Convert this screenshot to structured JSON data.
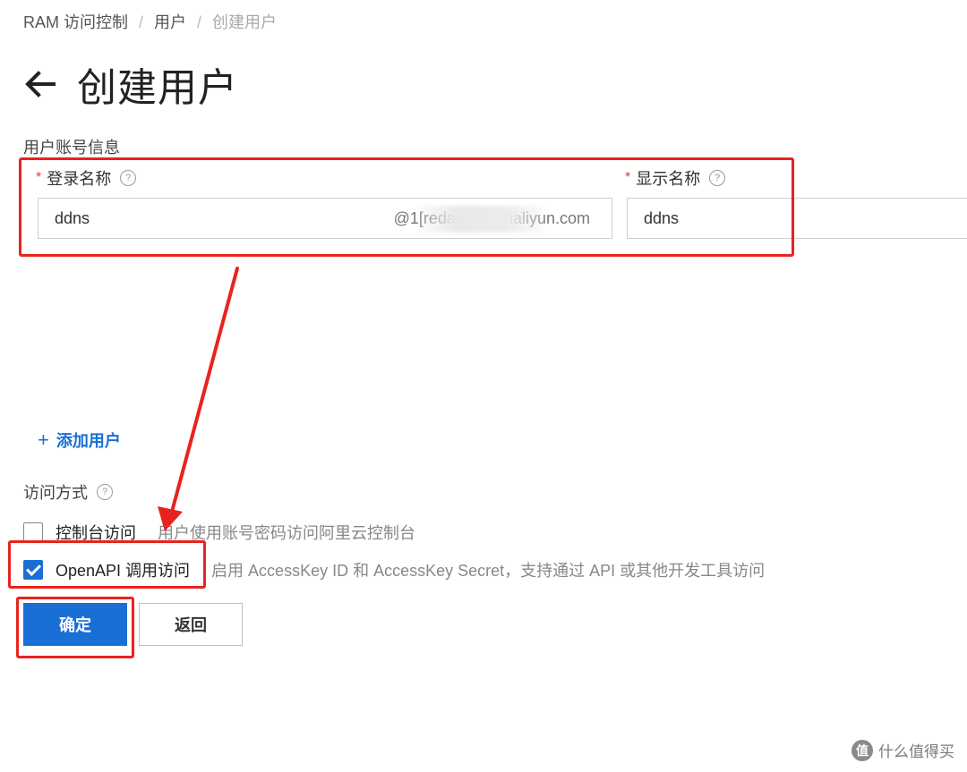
{
  "breadcrumb": {
    "items": [
      "RAM 访问控制",
      "用户",
      "创建用户"
    ],
    "separator": "/"
  },
  "header": {
    "title": "创建用户"
  },
  "form": {
    "section_label": "用户账号信息",
    "login_name": {
      "required_mark": "*",
      "label": "登录名称",
      "value": "ddns",
      "suffix": "@1[redacted].onaliyun.com"
    },
    "display_name": {
      "required_mark": "*",
      "label": "显示名称",
      "value": "ddns"
    },
    "help_glyph": "?",
    "add_user": {
      "plus": "+",
      "label": "添加用户"
    },
    "access": {
      "label": "访问方式",
      "options": [
        {
          "name": "控制台访问",
          "description": "用户使用账号密码访问阿里云控制台",
          "checked": false
        },
        {
          "name": "OpenAPI 调用访问",
          "description": "启用 AccessKey ID 和 AccessKey Secret，支持通过 API 或其他开发工具访问",
          "checked": true
        }
      ]
    }
  },
  "buttons": {
    "confirm": "确定",
    "back": "返回"
  },
  "watermark": {
    "logo_glyph": "值",
    "text": "什么值得买"
  },
  "colors": {
    "primary": "#1a6fd6",
    "annotation": "#e8231f",
    "required": "#e53935"
  }
}
